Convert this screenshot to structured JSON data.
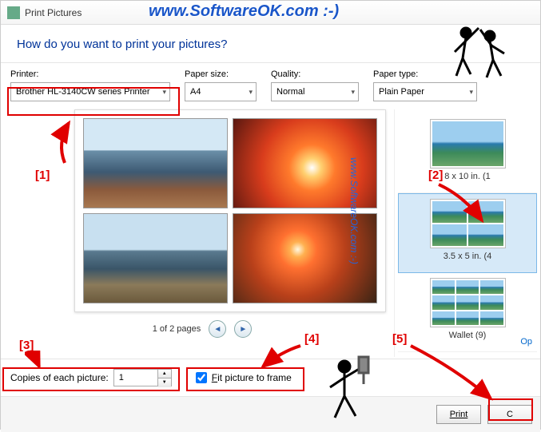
{
  "window": {
    "title": "Print Pictures"
  },
  "watermark": {
    "top": "www.SoftwareOK.com :-)",
    "side": "www.SoftwareOK.com :-)"
  },
  "header": {
    "question": "How do you want to print your pictures?"
  },
  "labels": {
    "printer": "Printer:",
    "paper_size": "Paper size:",
    "quality": "Quality:",
    "paper_type": "Paper type:",
    "copies": "Copies of each picture:",
    "fit_pre": "F",
    "fit_post": "it picture to frame",
    "options": "Op"
  },
  "values": {
    "printer": "Brother HL-3140CW series Printer",
    "paper_size": "A4",
    "quality": "Normal",
    "paper_type": "Plain Paper",
    "copies": "1",
    "fit_checked": true
  },
  "pager": {
    "text": "1 of 2 pages"
  },
  "layouts": {
    "items": [
      {
        "label": "8 x 10 in. (1"
      },
      {
        "label": "3.5 x 5 in. (4"
      },
      {
        "label": "Wallet (9)"
      }
    ],
    "selected_index": 1
  },
  "buttons": {
    "print": "Print",
    "cancel": "C"
  },
  "callouts": {
    "c1": "[1]",
    "c2": "[2]",
    "c3": "[3]",
    "c4": "[4]",
    "c5": "[5]"
  }
}
